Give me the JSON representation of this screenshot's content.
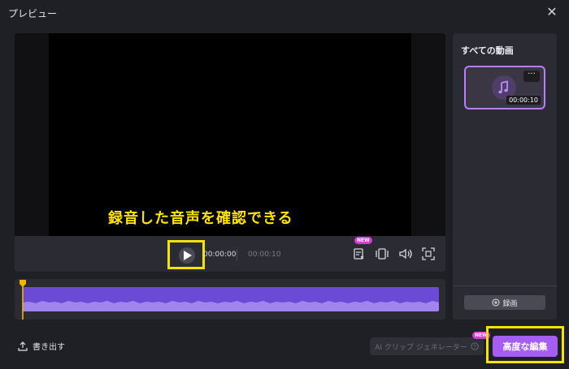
{
  "window": {
    "title": "プレビュー"
  },
  "preview": {
    "caption": "録音した音声を確認できる"
  },
  "player": {
    "current_time": "00:00:00",
    "total_time": "00:00:10",
    "new_badge": "NEW"
  },
  "sidebar": {
    "title": "すべての動画",
    "clip_duration": "00:00:10",
    "more_label": "···",
    "record_button": "録画"
  },
  "footer": {
    "export_label": "書き出す",
    "ai_clip_label": "AI クリップ ジェネレーター",
    "ai_new_badge": "NEW",
    "advanced_edit_label": "高度な編集"
  },
  "colors": {
    "accent_purple": "#a55ef0",
    "highlight_yellow": "#f3e500",
    "caption_yellow": "#ffe400",
    "waveform": "#6b4ad6",
    "new_badge": "#d73ad5"
  }
}
